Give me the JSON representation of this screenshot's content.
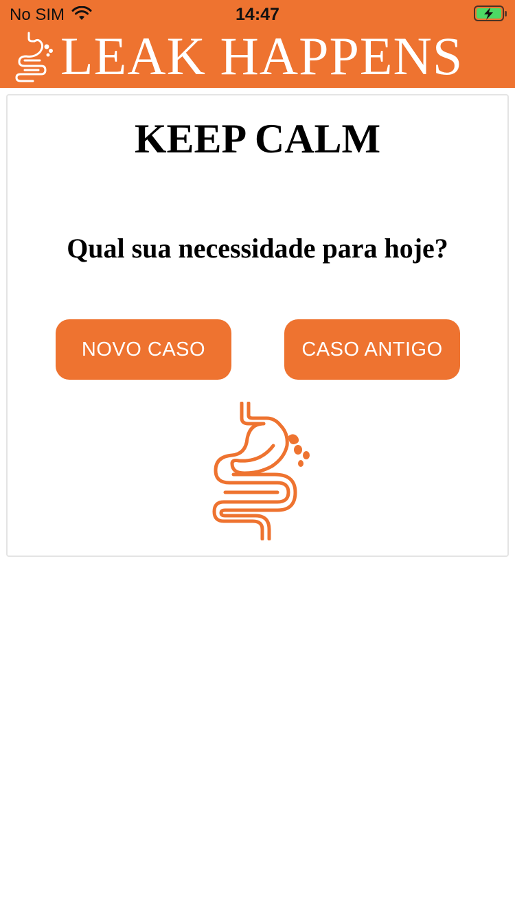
{
  "status_bar": {
    "carrier": "No SIM",
    "time": "14:47",
    "wifi_icon": "wifi-icon",
    "battery_icon": "battery-charging-icon"
  },
  "header": {
    "title": "LEAK HAPPENS",
    "logo_icon": "intestine-leak-icon",
    "background_color": "#ee7330"
  },
  "main": {
    "heading": "KEEP CALM",
    "question": "Qual sua necessidade para hoje?",
    "buttons": {
      "new_case": "NOVO CASO",
      "old_case": "CASO ANTIGO"
    },
    "illustration_icon": "intestine-leak-icon"
  },
  "colors": {
    "accent": "#ee7330",
    "battery_fill": "#4cd964"
  }
}
